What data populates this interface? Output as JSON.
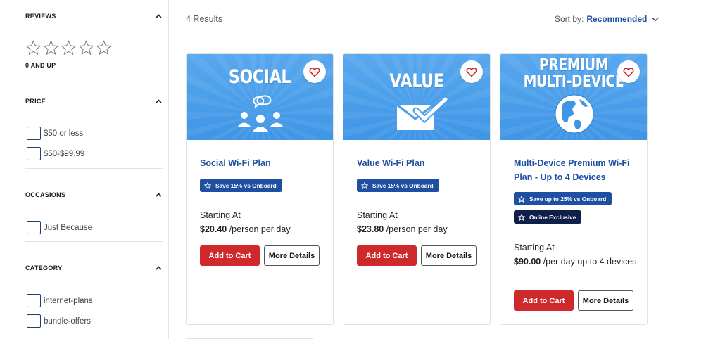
{
  "filters": {
    "reviews": {
      "title": "REVIEWS",
      "rating_label": "0 AND UP",
      "stars_selected": 0,
      "stars_total": 5
    },
    "price": {
      "title": "PRICE",
      "options": [
        {
          "label": "$50 or less",
          "checked": false
        },
        {
          "label": "$50-$99.99",
          "checked": false
        }
      ]
    },
    "occasions": {
      "title": "OCCASIONS",
      "options": [
        {
          "label": "Just Because",
          "checked": false
        }
      ]
    },
    "category": {
      "title": "CATEGORY",
      "options": [
        {
          "label": "internet-plans",
          "checked": false
        },
        {
          "label": "bundle-offers",
          "checked": false
        }
      ]
    }
  },
  "results": {
    "count_text": "4 Results"
  },
  "sort": {
    "label": "Sort by:",
    "value": "Recommended"
  },
  "products": [
    {
      "image_title": "SOCIAL",
      "image_icon": "people-chat-icon",
      "name": "Social Wi-Fi Plan",
      "badges": [
        {
          "text": "Save 15% vs Onboard",
          "style": "blue"
        }
      ],
      "starting_label": "Starting At",
      "price": "$20.40",
      "price_unit": " /person per day",
      "cart_label": "Add to Cart",
      "details_label": "More Details"
    },
    {
      "image_title": "VALUE",
      "image_icon": "envelope-check-icon",
      "name": "Value Wi-Fi Plan",
      "badges": [
        {
          "text": "Save 15% vs Onboard",
          "style": "blue"
        }
      ],
      "starting_label": "Starting At",
      "price": "$23.80",
      "price_unit": " /person per day",
      "cart_label": "Add to Cart",
      "details_label": "More Details"
    },
    {
      "image_title_line1": "PREMIUM",
      "image_title_line2": "MULTI-DEVICE",
      "image_icon": "globe-icon",
      "name": "Multi-Device Premium Wi-Fi Plan - Up to 4 Devices",
      "badges": [
        {
          "text": "Save up to 25% vs Onboard",
          "style": "blue"
        },
        {
          "text": "Online Exclusive",
          "style": "dark"
        }
      ],
      "starting_label": "Starting At",
      "price": "$90.00",
      "price_unit": " /per day up to 4 devices",
      "cart_label": "Add to Cart",
      "details_label": "More Details"
    }
  ],
  "colors": {
    "brand_blue": "#1e4fa3",
    "badge_dark": "#0e1f4a",
    "cart_red": "#d0292b",
    "image_blue": "#4a9eea",
    "heart_red": "#d0292b"
  }
}
